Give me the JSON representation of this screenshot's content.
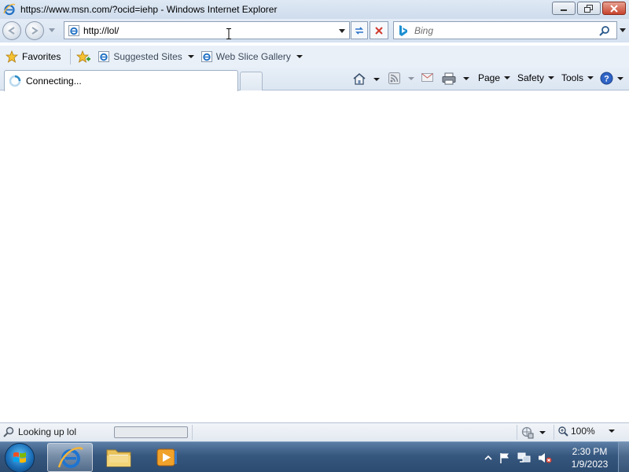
{
  "window": {
    "title": "https://www.msn.com/?ocid=iehp - Windows Internet Explorer"
  },
  "navigation": {
    "address_value": "http://lol/",
    "search_placeholder": "Bing"
  },
  "favorites_bar": {
    "favorites_label": "Favorites",
    "suggested_sites_label": "Suggested Sites",
    "web_slice_gallery_label": "Web Slice Gallery"
  },
  "tabs": [
    {
      "label": "Connecting..."
    }
  ],
  "command_bar": {
    "page_label": "Page",
    "safety_label": "Safety",
    "tools_label": "Tools"
  },
  "status_bar": {
    "status_text": "Looking up lol",
    "zoom_level": "100%",
    "progress_fraction": 0.0
  },
  "taskbar": {
    "pinned": [
      "internet-explorer",
      "windows-explorer",
      "windows-media-player"
    ],
    "clock_time": "2:30 PM",
    "clock_date": "1/9/2023"
  },
  "colors": {
    "title_bar": "#dfe9f5",
    "taskbar": "#36577e",
    "close_button": "#c7432d",
    "stop_red": "#d03a2e"
  }
}
